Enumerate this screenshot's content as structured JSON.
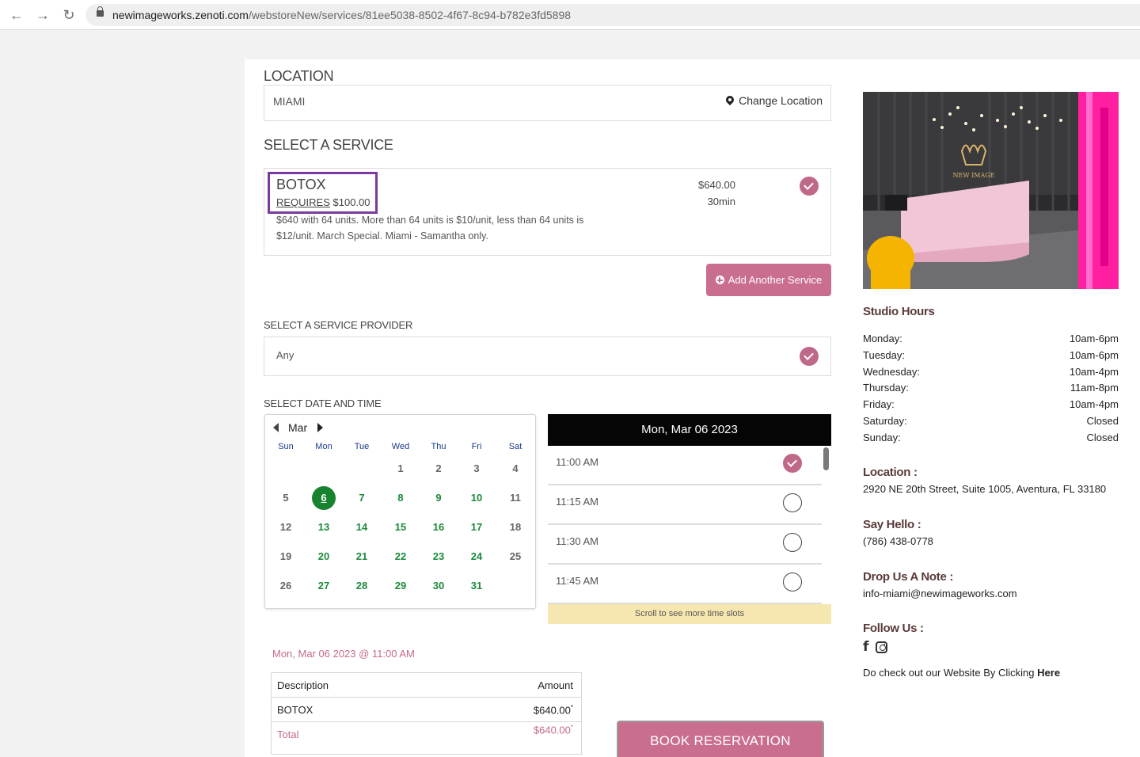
{
  "browser": {
    "url_host": "newimageworks.zenoti.com",
    "url_path": "/webstoreNew/services/81ee5038-8502-4f67-8c94-b782e3fd5898"
  },
  "location": {
    "title": "LOCATION",
    "value": "MIAMI",
    "change_label": "Change Location"
  },
  "service": {
    "title": "SELECT A SERVICE",
    "name": "BOTOX",
    "requires_label": "REQUIRES",
    "requires_amount": "$100.00",
    "description": "$640 with 64 units. More than 64 units is $10/unit, less than 64 units is $12/unit. March Special. Miami - Samantha only.",
    "price": "$640.00",
    "duration": "30min",
    "add_button": "Add Another Service"
  },
  "provider": {
    "title": "SELECT A SERVICE PROVIDER",
    "value": "Any"
  },
  "datetime": {
    "title": "SELECT DATE AND TIME",
    "month": "Mar",
    "dow": [
      "Sun",
      "Mon",
      "Tue",
      "Wed",
      "Thu",
      "Fri",
      "Sat"
    ],
    "weeks": [
      [
        "",
        "",
        "",
        "1",
        "2",
        "3",
        "4"
      ],
      [
        "5",
        "6",
        "7",
        "8",
        "9",
        "10",
        "11"
      ],
      [
        "12",
        "13",
        "14",
        "15",
        "16",
        "17",
        "18"
      ],
      [
        "19",
        "20",
        "21",
        "22",
        "23",
        "24",
        "25"
      ],
      [
        "26",
        "27",
        "28",
        "29",
        "30",
        "31",
        ""
      ]
    ],
    "available_days": [
      "6",
      "7",
      "8",
      "9",
      "10",
      "13",
      "14",
      "15",
      "16",
      "17",
      "20",
      "21",
      "22",
      "23",
      "24",
      "27",
      "28",
      "29",
      "30",
      "31"
    ],
    "selected_day": "6",
    "slots_header": "Mon, Mar 06 2023",
    "slots": [
      {
        "time": "11:00 AM",
        "selected": true
      },
      {
        "time": "11:15 AM",
        "selected": false
      },
      {
        "time": "11:30 AM",
        "selected": false
      },
      {
        "time": "11:45 AM",
        "selected": false
      }
    ],
    "scroll_hint": "Scroll to see more time slots"
  },
  "summary": {
    "selected_datetime": "Mon, Mar 06 2023 @ 11:00 AM",
    "col_description": "Description",
    "col_amount": "Amount",
    "item_name": "BOTOX",
    "item_amount": "$640.00",
    "total_label": "Total",
    "total_amount": "$640.00",
    "asterisk": "*",
    "book_button": "BOOK RESERVATION"
  },
  "sidebar": {
    "hours_title": "Studio Hours",
    "hours": [
      {
        "day": "Monday:",
        "time": "10am-6pm"
      },
      {
        "day": "Tuesday:",
        "time": "10am-6pm"
      },
      {
        "day": "Wednesday:",
        "time": "10am-4pm"
      },
      {
        "day": "Thursday:",
        "time": "11am-8pm"
      },
      {
        "day": "Friday:",
        "time": "10am-4pm"
      },
      {
        "day": "Saturday:",
        "time": "Closed"
      },
      {
        "day": "Sunday:",
        "time": "Closed"
      }
    ],
    "location_title": "Location :",
    "address": "2920 NE 20th Street, Suite 1005, Aventura, FL 33180",
    "hello_title": "Say Hello :",
    "phone": "(786) 438-0778",
    "note_title": "Drop Us A Note :",
    "email": "info-miami@newimageworks.com",
    "follow_title": "Follow Us :",
    "website_text": "Do check out our Website By Clicking ",
    "website_link": "Here",
    "logo_text": "NEW IMAGE"
  },
  "colors": {
    "accent_pink": "#c96e8f",
    "selected_green": "#17832f",
    "highlight_purple": "#7b3b9e"
  }
}
